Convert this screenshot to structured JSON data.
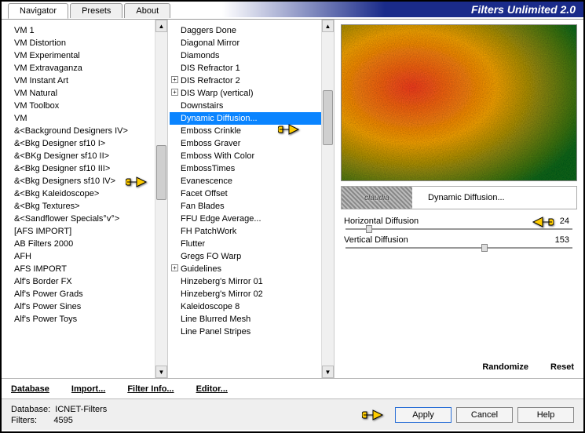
{
  "app": {
    "title": "Filters Unlimited 2.0"
  },
  "tabs": {
    "navigator": "Navigator",
    "presets": "Presets",
    "about": "About"
  },
  "left": {
    "items": [
      "VM 1",
      "VM Distortion",
      "VM Experimental",
      "VM Extravaganza",
      "VM Instant Art",
      "VM Natural",
      "VM Toolbox",
      "VM",
      "&<Background Designers IV>",
      "&<Bkg Designer sf10 I>",
      "&<BKg Designer sf10 II>",
      "&<Bkg Designer sf10 III>",
      "&<Bkg Designers sf10 IV>",
      "&<Bkg Kaleidoscope>",
      "&<Bkg Textures>",
      "&<Sandflower Specials°v°>",
      "[AFS IMPORT]",
      "AB Filters 2000",
      "AFH",
      "AFS IMPORT",
      "Alf's Border FX",
      "Alf's Power Grads",
      "Alf's Power Sines",
      "Alf's Power Toys"
    ]
  },
  "middle": {
    "items": [
      {
        "label": "Daggers Done"
      },
      {
        "label": "Diagonal Mirror"
      },
      {
        "label": "Diamonds"
      },
      {
        "label": "DIS Refractor 1"
      },
      {
        "label": "DIS Refractor 2",
        "expand": true
      },
      {
        "label": "DIS Warp (vertical)",
        "expand": true
      },
      {
        "label": "Downstairs"
      },
      {
        "label": "Dynamic Diffusion...",
        "selected": true
      },
      {
        "label": "Emboss Crinkle"
      },
      {
        "label": "Emboss Graver"
      },
      {
        "label": "Emboss With Color"
      },
      {
        "label": "EmbossTimes"
      },
      {
        "label": "Evanescence"
      },
      {
        "label": "Facet Offset"
      },
      {
        "label": "Fan Blades"
      },
      {
        "label": "FFU Edge Average..."
      },
      {
        "label": "FH PatchWork"
      },
      {
        "label": "Flutter"
      },
      {
        "label": "Gregs FO Warp"
      },
      {
        "label": "Guidelines",
        "expand": true
      },
      {
        "label": "Hinzeberg's Mirror 01"
      },
      {
        "label": "Hinzeberg's Mirror 02"
      },
      {
        "label": "Kaleidoscope 8"
      },
      {
        "label": "Line Blurred Mesh"
      },
      {
        "label": "Line Panel Stripes"
      }
    ]
  },
  "filter": {
    "logo": "claudia",
    "name": "Dynamic Diffusion...",
    "params": [
      {
        "label": "Horizontal Diffusion",
        "value": 24
      },
      {
        "label": "Vertical Diffusion",
        "value": 153
      }
    ]
  },
  "buttons": {
    "database": "Database",
    "import": "Import...",
    "filterinfo": "Filter Info...",
    "editor": "Editor...",
    "randomize": "Randomize",
    "reset": "Reset",
    "apply": "Apply",
    "cancel": "Cancel",
    "help": "Help"
  },
  "status": {
    "database_label": "Database:",
    "database_value": "ICNET-Filters",
    "filters_label": "Filters:",
    "filters_value": "4595"
  }
}
